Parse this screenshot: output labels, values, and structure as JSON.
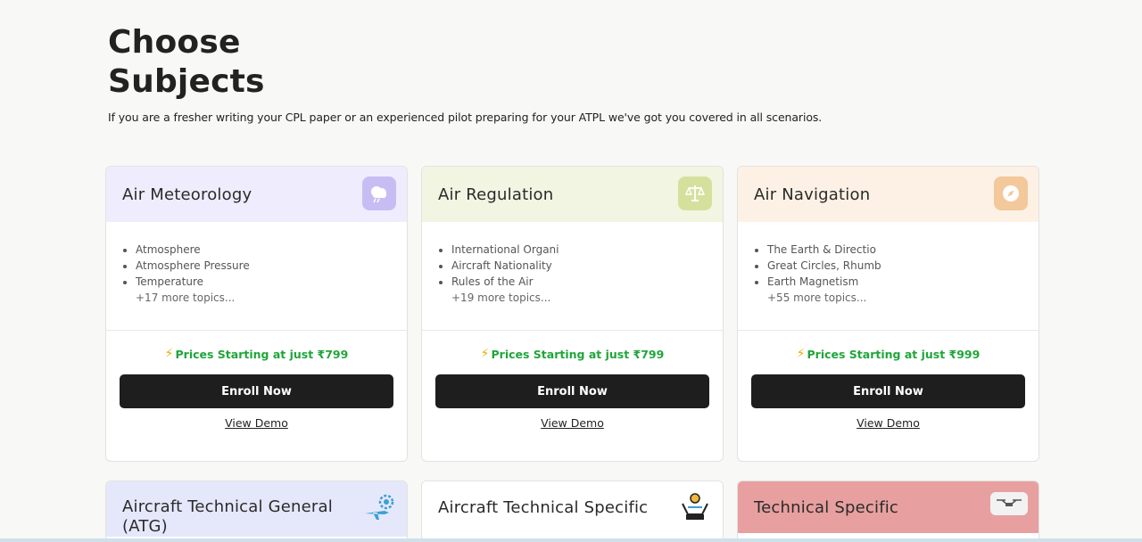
{
  "header": {
    "title_line1": "Choose",
    "title_line2": "Subjects",
    "subtitle": "If you are a fresher writing your CPL paper or an experienced pilot preparing for your ATPL we've got you covered in all scenarios."
  },
  "cards": [
    {
      "title": "Air Meteorology",
      "icon": "cloud-icon",
      "head_color": "#efedfd",
      "icon_bg": "#c8bdf3",
      "topics": [
        "Atmosphere",
        "Atmosphere Pressure",
        "Temperature"
      ],
      "more": "+17 more topics...",
      "price": "Prices Starting at just ₹799",
      "enroll_label": "Enroll Now",
      "demo_label": "View Demo"
    },
    {
      "title": "Air Regulation",
      "icon": "scales-icon",
      "head_color": "#f1f5e2",
      "icon_bg": "#d6e09d",
      "topics": [
        "International Organi",
        "Aircraft Nationality",
        "Rules of the Air"
      ],
      "more": "+19 more topics...",
      "price": "Prices Starting at just ₹799",
      "enroll_label": "Enroll Now",
      "demo_label": "View Demo"
    },
    {
      "title": "Air Navigation",
      "icon": "compass-icon",
      "head_color": "#fdf1e5",
      "icon_bg": "#f3c89a",
      "topics": [
        "The Earth & Directio",
        "Great Circles, Rhumb",
        "Earth Magnetism"
      ],
      "more": "+55 more topics...",
      "price": "Prices Starting at just ₹999",
      "enroll_label": "Enroll Now",
      "demo_label": "View Demo"
    }
  ],
  "cards_row2": [
    {
      "title_line1": "Aircraft Technical General",
      "title_line2": "(ATG)",
      "icon": "plane-gear-icon",
      "head_color": "#e5e8fb"
    },
    {
      "title_line1": "Aircraft Technical Specific",
      "title_line2": "",
      "icon": "aircraft-specific-icon",
      "head_color": "#ffffff"
    },
    {
      "title_line1": "Technical Specific",
      "title_line2": "",
      "icon": "drone-icon",
      "head_color": "#e7a09f"
    }
  ]
}
